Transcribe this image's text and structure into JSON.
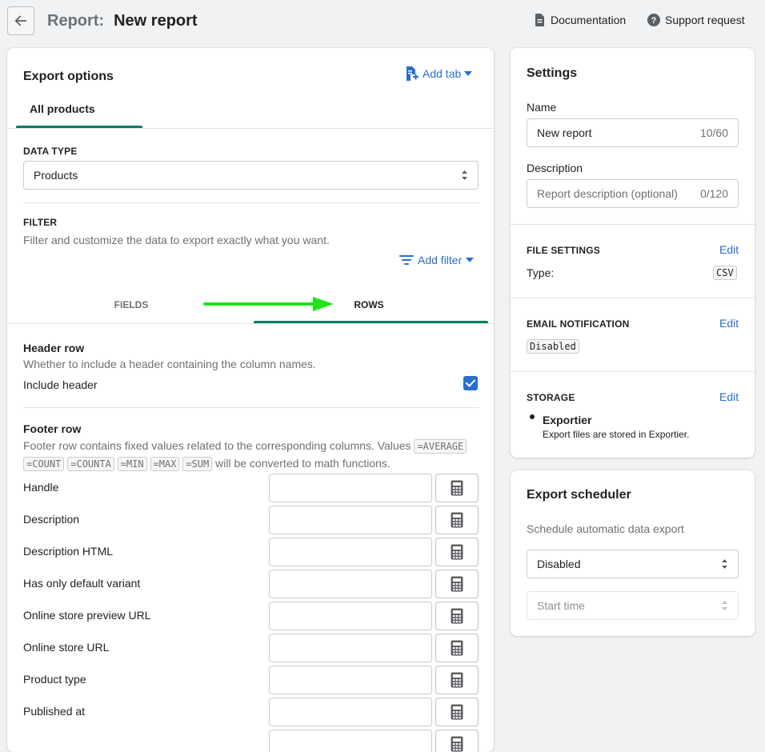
{
  "header": {
    "crumb": "Report:",
    "title": "New report",
    "documentation": "Documentation",
    "support": "Support request"
  },
  "export": {
    "title": "Export options",
    "add_tab": "Add tab",
    "tab_active": "All products",
    "data_type_label": "DATA TYPE",
    "data_type_value": "Products",
    "filter_label": "FILTER",
    "filter_desc": "Filter and customize the data to export exactly what you want.",
    "add_filter": "Add filter",
    "subtab_fields": "FIELDS",
    "subtab_rows": "ROWS",
    "header_row_title": "Header row",
    "header_row_desc": "Whether to include a header containing the column names.",
    "include_header": "Include header",
    "include_header_checked": true,
    "footer_row_title": "Footer row",
    "footer_desc_1": "Footer row contains fixed values related to the corresponding columns. Values",
    "footer_desc_2": "will be converted to math functions.",
    "footer_funcs": [
      "=AVERAGE",
      "=COUNT",
      "=COUNTA",
      "=MIN",
      "=MAX",
      "=SUM"
    ],
    "fields": [
      "Handle",
      "Description",
      "Description HTML",
      "Has only default variant",
      "Online store preview URL",
      "Online store URL",
      "Product type",
      "Published at"
    ]
  },
  "settings": {
    "title": "Settings",
    "name_label": "Name",
    "name_value": "New report",
    "name_counter": "10/60",
    "desc_label": "Description",
    "desc_placeholder": "Report description (optional)",
    "desc_counter": "0/120",
    "file_settings": "FILE SETTINGS",
    "edit": "Edit",
    "type_label": "Type:",
    "type_value": "CSV",
    "email_notification": "EMAIL NOTIFICATION",
    "email_value": "Disabled",
    "storage": "STORAGE",
    "storage_name": "Exportier",
    "storage_desc": "Export files are stored in Exportier."
  },
  "scheduler": {
    "title": "Export scheduler",
    "desc": "Schedule automatic data export",
    "status_value": "Disabled",
    "start_time_placeholder": "Start time"
  },
  "colors": {
    "accent": "#2c6ecb",
    "tab_underline": "#008060",
    "arrow": "#22e31b"
  }
}
